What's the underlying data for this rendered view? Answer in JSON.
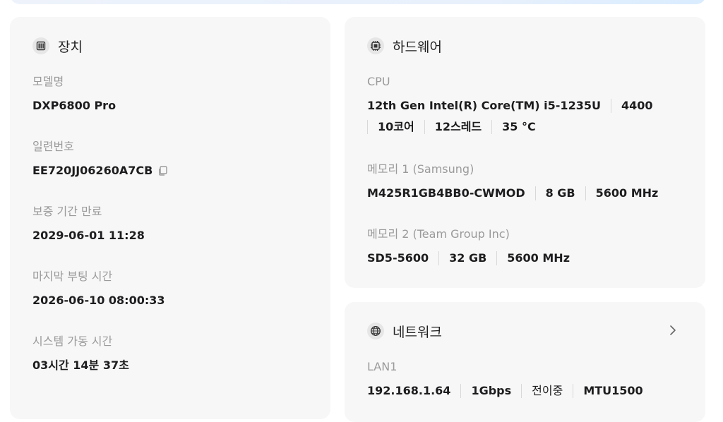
{
  "device": {
    "title": "장치",
    "icon": "device-icon",
    "fields": [
      {
        "label": "모델명",
        "value": "DXP6800 Pro"
      },
      {
        "label": "일련번호",
        "value": "EE720JJ06260A7CB"
      },
      {
        "label": "보증 기간 만료",
        "value": "2029-06-01 11:28"
      },
      {
        "label": "마지막 부팅 시간",
        "value": "2026-06-10 08:00:33"
      },
      {
        "label": "시스템 가동 시간",
        "value": "03시간 14분 37초"
      }
    ]
  },
  "hardware": {
    "title": "하드웨어",
    "icon": "chip-icon",
    "cpu": {
      "label": "CPU",
      "model": "12th Gen Intel(R) Core(TM) i5-1235U",
      "freq": "4400",
      "cores": "10코어",
      "threads": "12스레드",
      "temp": "35 °C"
    },
    "memory1": {
      "label": "메모리 1 (Samsung)",
      "model": "M425R1GB4BB0-CWMOD",
      "size": "8 GB",
      "speed": "5600 MHz"
    },
    "memory2": {
      "label": "메모리 2 (Team Group Inc)",
      "model": "SD5-5600",
      "size": "32 GB",
      "speed": "5600 MHz"
    }
  },
  "network": {
    "title": "네트워크",
    "icon": "globe-icon",
    "lan1": {
      "label": "LAN1",
      "ip": "192.168.1.64",
      "speed": "1Gbps",
      "status": "전이중",
      "mtu": "MTU1500"
    }
  }
}
